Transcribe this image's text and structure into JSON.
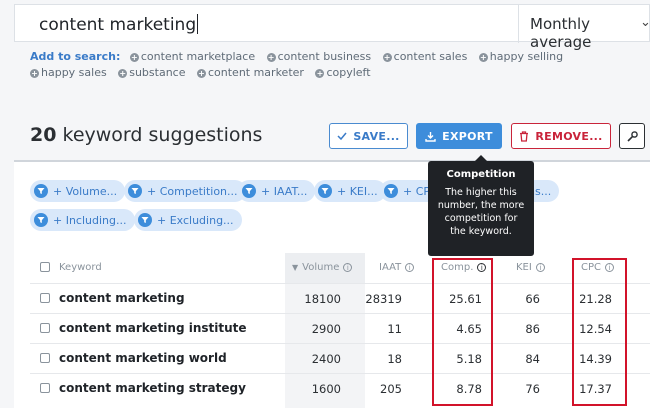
{
  "search": {
    "query": "content marketing",
    "period": "Monthly average"
  },
  "add_to_search": {
    "label": "Add to search:",
    "items": [
      "content marketplace",
      "content business",
      "content sales",
      "happy selling",
      "happy sales",
      "substance",
      "content marketer",
      "copyleft"
    ]
  },
  "suggestions": {
    "count": "20",
    "label": "keyword suggestions"
  },
  "buttons": {
    "save": "SAVE...",
    "export": "EXPORT",
    "remove": "REMOVE..."
  },
  "filters": [
    "+ Volume...",
    "+ Competition...",
    "+ IAAT...",
    "+ KEI...",
    "+ CP",
    "ns...",
    "+ Including...",
    "+ Excluding..."
  ],
  "tooltip": {
    "title": "Competition",
    "body": "The higher this number, the more competition for the keyword."
  },
  "table": {
    "columns": [
      "Keyword",
      "Volume",
      "IAAT",
      "Comp.",
      "KEI",
      "CPC"
    ],
    "rows": [
      {
        "keyword": "content marketing",
        "volume": "18100",
        "iaat": "28319",
        "comp": "25.61",
        "kei": "66",
        "cpc": "21.28"
      },
      {
        "keyword": "content marketing institute",
        "volume": "2900",
        "iaat": "11",
        "comp": "4.65",
        "kei": "86",
        "cpc": "12.54"
      },
      {
        "keyword": "content marketing world",
        "volume": "2400",
        "iaat": "18",
        "comp": "5.18",
        "kei": "84",
        "cpc": "14.39"
      },
      {
        "keyword": "content marketing strategy",
        "volume": "1600",
        "iaat": "205",
        "comp": "8.78",
        "kei": "76",
        "cpc": "17.37"
      }
    ]
  },
  "colors": {
    "accent": "#3d8ddb",
    "danger": "#c9243a",
    "highlight": "#d2132a"
  }
}
